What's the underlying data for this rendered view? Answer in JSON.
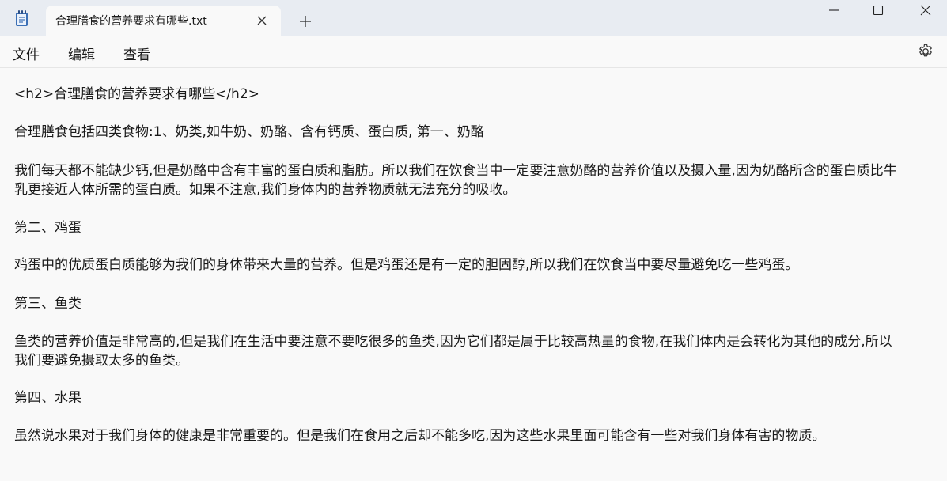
{
  "window": {
    "tab_title": "合理膳食的营养要求有哪些.txt",
    "new_tab_symbol": "+"
  },
  "menu": {
    "file": "文件",
    "edit": "编辑",
    "view": "查看"
  },
  "icons": {
    "app": "notepad-icon",
    "close_tab": "close-icon",
    "new_tab": "plus-icon",
    "minimize": "minimize-icon",
    "maximize": "maximize-icon",
    "close_window": "close-icon",
    "settings": "gear-icon"
  },
  "document": {
    "lines": [
      "<h2>合理膳食的营养要求有哪些</h2>",
      "合理膳食包括四类食物:1、奶类,如牛奶、奶酪、含有钙质、蛋白质, 第一、奶酪",
      "我们每天都不能缺少钙,但是奶酪中含有丰富的蛋白质和脂肪。所以我们在饮食当中一定要注意奶酪的营养价值以及摄入量,因为奶酪所含的蛋白质比牛",
      "乳更接近人体所需的蛋白质。如果不注意,我们身体内的营养物质就无法充分的吸收。",
      "第二、鸡蛋",
      "鸡蛋中的优质蛋白质能够为我们的身体带来大量的营养。但是鸡蛋还是有一定的胆固醇,所以我们在饮食当中要尽量避免吃一些鸡蛋。",
      "第三、鱼类",
      "鱼类的营养价值是非常高的,但是我们在生活中要注意不要吃很多的鱼类,因为它们都是属于比较高热量的食物,在我们体内是会转化为其他的成分,所以",
      "我们要避免摄取太多的鱼类。",
      "第四、水果",
      "虽然说水果对于我们身体的健康是非常重要的。但是我们在食用之后却不能多吃,因为这些水果里面可能含有一些对我们身体有害的物质。"
    ]
  }
}
